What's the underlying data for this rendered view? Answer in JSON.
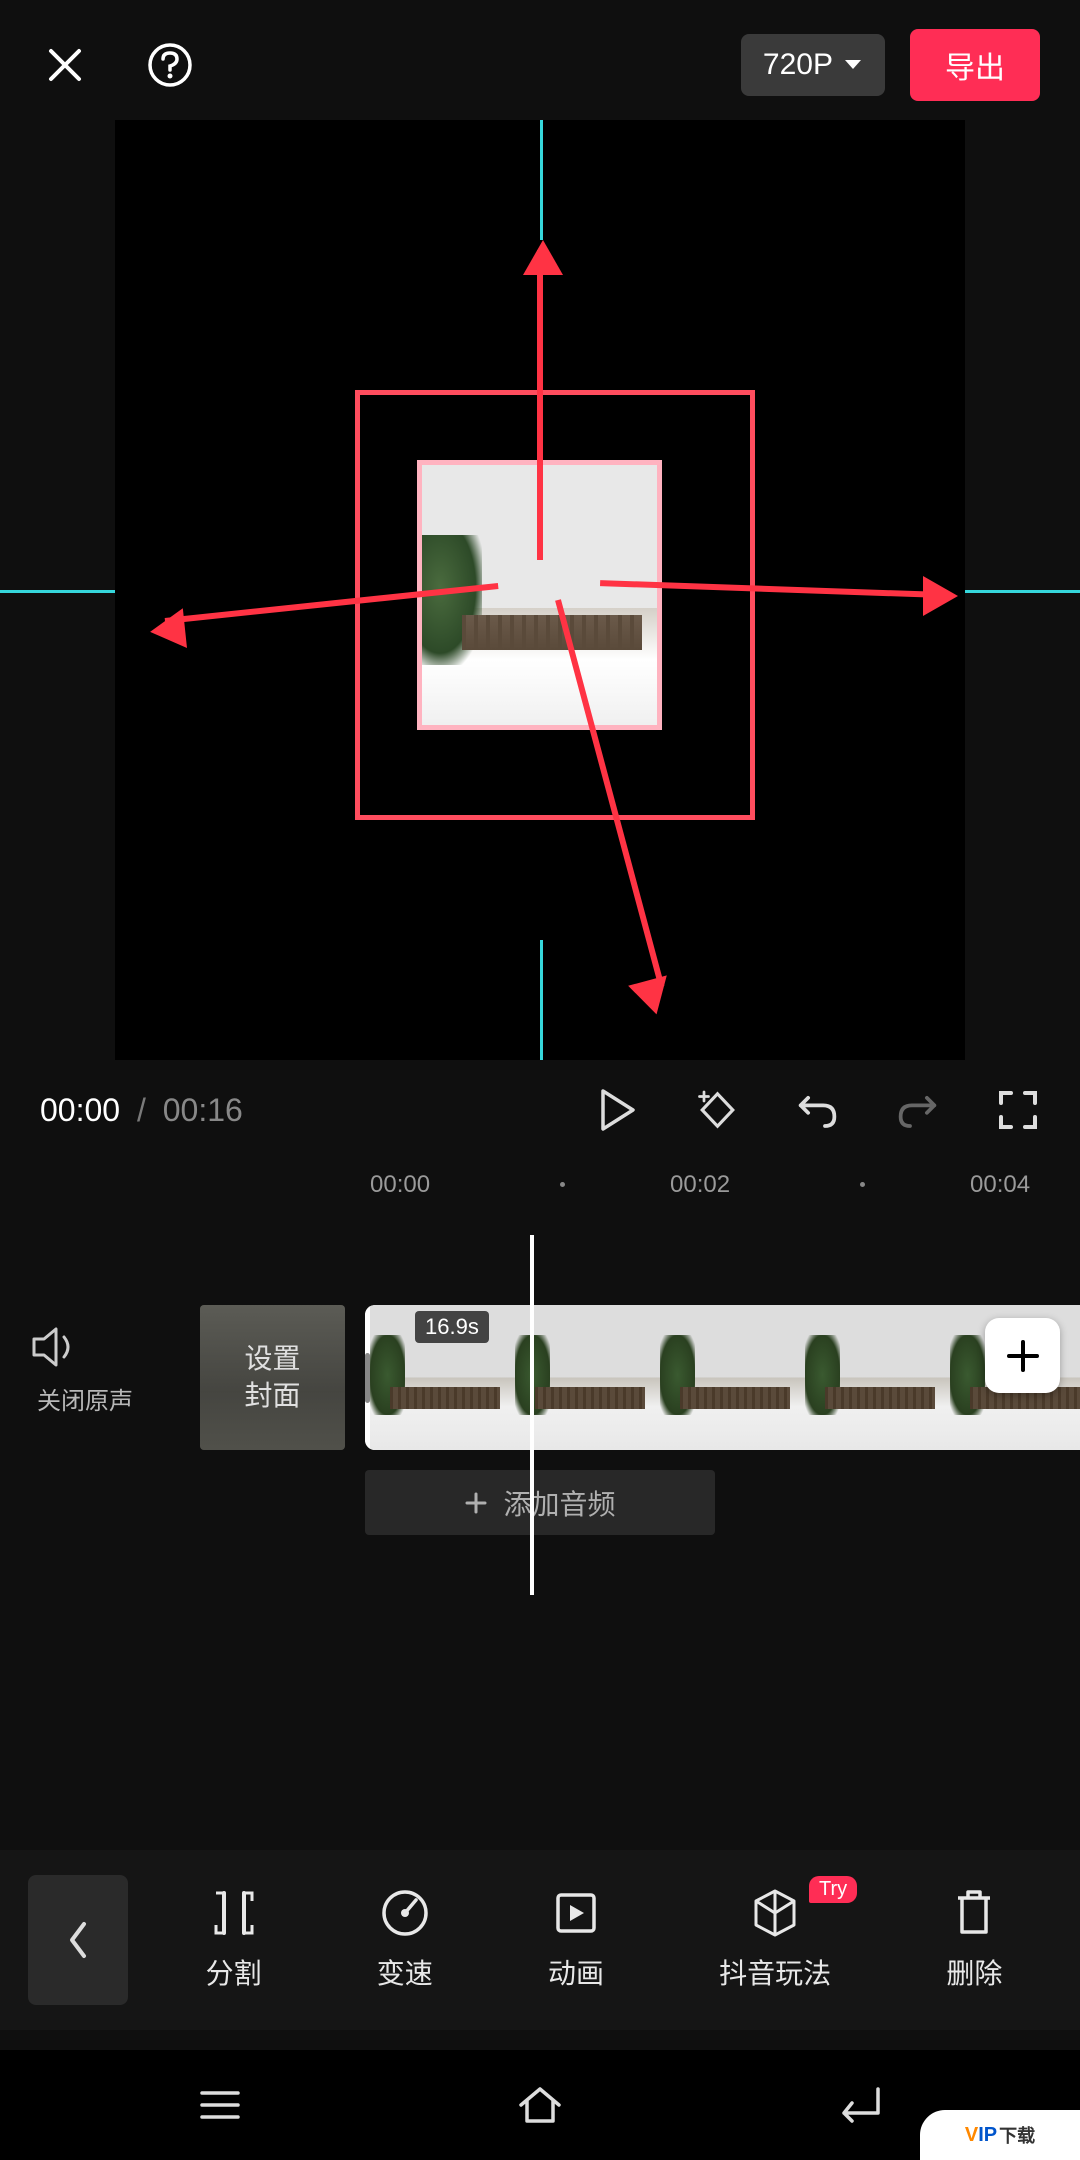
{
  "header": {
    "resolution_label": "720P",
    "export_label": "导出"
  },
  "playback": {
    "current_time": "00:00",
    "separator": "/",
    "total_time": "00:16"
  },
  "ruler": {
    "marks": [
      "00:00",
      "00:02",
      "00:04"
    ]
  },
  "timeline": {
    "mute_label": "关闭原声",
    "cover_line1": "设置",
    "cover_line2": "封面",
    "clip_duration": "16.9s",
    "add_audio_label": "添加音频"
  },
  "toolbar": {
    "tools": [
      {
        "label": "分割",
        "icon": "split"
      },
      {
        "label": "变速",
        "icon": "speed"
      },
      {
        "label": "动画",
        "icon": "animation"
      },
      {
        "label": "抖音玩法",
        "icon": "cube",
        "badge": "Try"
      },
      {
        "label": "删除",
        "icon": "delete"
      }
    ]
  },
  "watermark": {
    "text_v": "V",
    "text_ip": "IP",
    "text_suffix": "下载"
  }
}
